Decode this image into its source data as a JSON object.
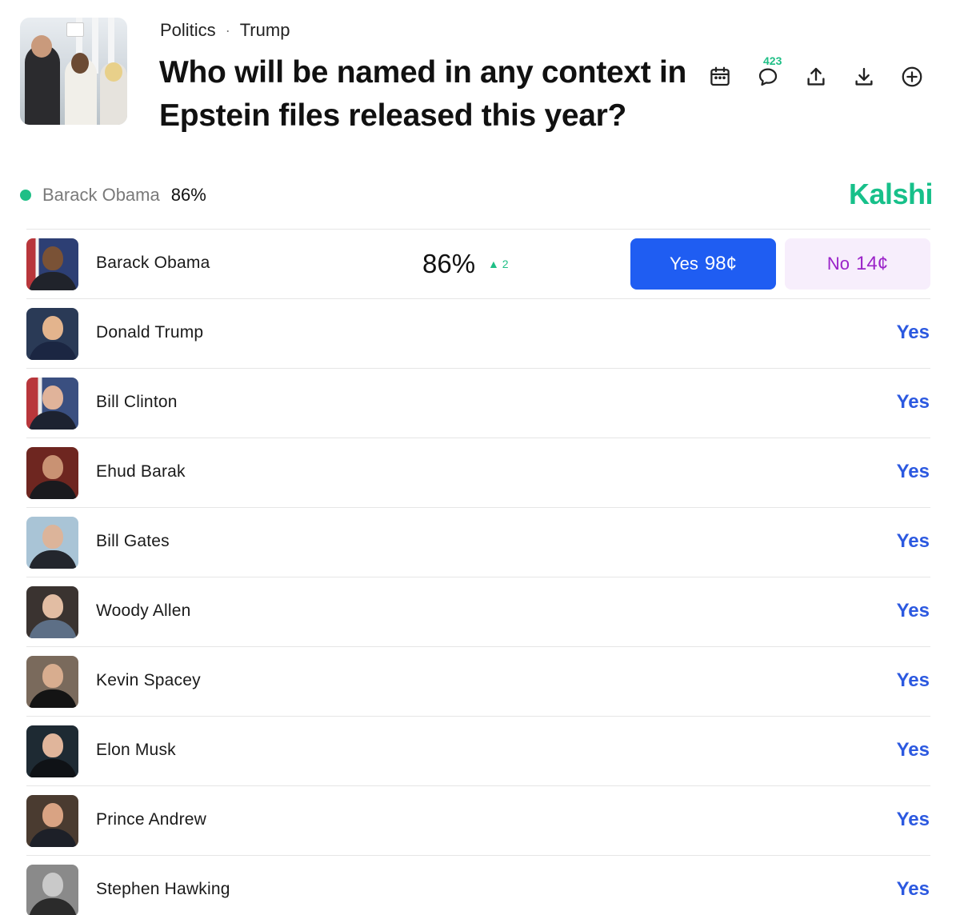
{
  "breadcrumb": {
    "category": "Politics",
    "separator": "·",
    "subcategory": "Trump"
  },
  "title": "Who will be named in any context in Epstein files released this year?",
  "toolbar": {
    "comment_count": "423",
    "icons": [
      "calendar-icon",
      "comment-icon",
      "share-icon",
      "download-icon",
      "add-icon"
    ]
  },
  "leader": {
    "name": "Barack Obama",
    "chance": "86%"
  },
  "brand": "Kalshi",
  "colors": {
    "brand": "#17c08a",
    "yes_button": "#1f5df2",
    "no_button_bg": "#f7eefc",
    "no_text": "#9b24c9",
    "yes_link": "#2c59e0"
  },
  "rows": [
    {
      "name": "Barack Obama",
      "chance": "86%",
      "delta": "▲ 2",
      "yes_label": "Yes",
      "yes_price": "98¢",
      "no_label": "No",
      "no_price": "14¢"
    },
    {
      "name": "Donald Trump",
      "yes_label": "Yes"
    },
    {
      "name": "Bill Clinton",
      "yes_label": "Yes"
    },
    {
      "name": "Ehud Barak",
      "yes_label": "Yes"
    },
    {
      "name": "Bill Gates",
      "yes_label": "Yes"
    },
    {
      "name": "Woody Allen",
      "yes_label": "Yes"
    },
    {
      "name": "Kevin Spacey",
      "yes_label": "Yes"
    },
    {
      "name": "Elon Musk",
      "yes_label": "Yes"
    },
    {
      "name": "Prince Andrew",
      "yes_label": "Yes"
    },
    {
      "name": "Stephen Hawking",
      "yes_label": "Yes"
    }
  ]
}
